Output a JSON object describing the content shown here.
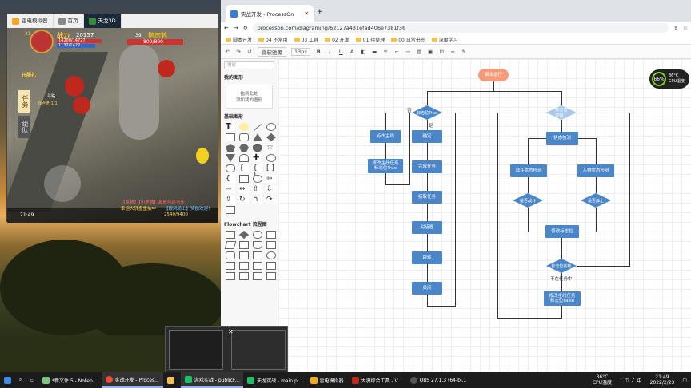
{
  "emulator": {
    "tabs": [
      {
        "label": "雷电模拟器"
      },
      {
        "label": "首页"
      },
      {
        "label": "天龙3D"
      }
    ],
    "game": {
      "level": "31",
      "power_label": "战力",
      "power": "20157",
      "hp": "14200/14727",
      "mp": "1137/1422",
      "target_level": "39",
      "target_name": "鹊摩鹤",
      "target_hp": "800/800",
      "side_tabs": [
        "任务",
        "组队"
      ],
      "quest_gift": "开服礼",
      "quest_path": "寻路",
      "quest_text": "找卢老 1/1",
      "time": "21:49",
      "chat1": "【系统】【小虎啸】真是鸿运当头！",
      "chat2": "幸运大转盘重抽中",
      "chat3": "【跟风骑士】奖励欢迎！",
      "coords": "2540/9400"
    }
  },
  "browser": {
    "tab_title": "实战开发 - ProcessOn",
    "url": "processon.com/diagraming/62127a431efad406e7381f36",
    "bookmarks": [
      "脚本开发",
      "04 不常用",
      "03 工具",
      "02 开发",
      "01 待整理",
      "00 日常书签",
      "深度学习"
    ],
    "toolbar": {
      "font": "微软雅黑",
      "size": "13px",
      "items": [
        "↶",
        "↷",
        "↺",
        "B",
        "I",
        "U",
        "A"
      ]
    },
    "sidebar": {
      "search_placeholder": "搜索",
      "my_shapes": "我的图形",
      "drop_hint_1": "拖到此处",
      "drop_hint_2": "添加我的图形",
      "basic_shapes": "基础图形",
      "flowchart": "Flowchart 流程图"
    },
    "diagram": {
      "start": "脚本运行",
      "left": {
        "d1": "标志位True",
        "yes": "是",
        "no": "否",
        "n_click": "点击主线",
        "n_modify": "修改主线任务\n标志位True",
        "confirm": "确定",
        "complete": "完成任务",
        "accept": "接取任务",
        "dialog": "对话框",
        "skip": "跳转",
        "close": "关闭"
      },
      "right": {
        "d1": "标志位\n选择",
        "state": "状态检测",
        "battle": "战斗状态检测",
        "human": "人物状态检测",
        "is_battle": "是否战斗",
        "is_still": "是否静止",
        "modify_flag": "修改标志位",
        "d2": "标志位判断",
        "no_task": "不在任务中",
        "modify_false": "修改主线任务\n标志位False"
      }
    }
  },
  "cpu": {
    "percent": "66%",
    "temp": "36°C",
    "label": "CPU温度"
  },
  "taskbar": {
    "items": [
      "*新文件 5 - Notep...",
      "实战开发 - Proces...",
      "",
      "游戏实战 - publicF...",
      "天龙实战 - main.p...",
      "雷电模拟器",
      "大漠综合工具 - V...",
      "OBS 27.1.3 (64-bi..."
    ],
    "temp": "36°C",
    "temp_label": "CPU温度",
    "time": "21:49",
    "date": "2022/2/23"
  },
  "colors": {
    "node": "#4a86c8",
    "start": "#f59b7a",
    "accent": "#7ed321"
  }
}
